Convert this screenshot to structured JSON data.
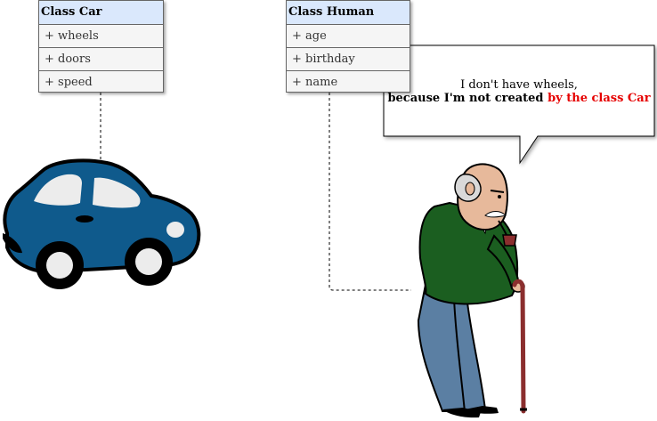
{
  "classes": {
    "car": {
      "title": "Class Car",
      "attributes": [
        "+ wheels",
        "+ doors",
        "+ speed"
      ]
    },
    "human": {
      "title": "Class Human",
      "attributes": [
        "+ age",
        "+ birthday",
        "+ name"
      ]
    }
  },
  "callout": {
    "line1": "I don't have wheels,",
    "line2_bold": "because I'm not created ",
    "line2_red": "by the class Car"
  },
  "colors": {
    "header_fill": "#dae8fc",
    "body_fill": "#f5f5f5",
    "border": "#666666",
    "car_body": "#0f5a8c",
    "sweater": "#1b5e20",
    "pants": "#5b7fa3",
    "cane": "#8b2e2e",
    "highlight_red": "#e60000"
  },
  "icons": {
    "car": "car-icon",
    "old_man": "old-man-icon"
  }
}
